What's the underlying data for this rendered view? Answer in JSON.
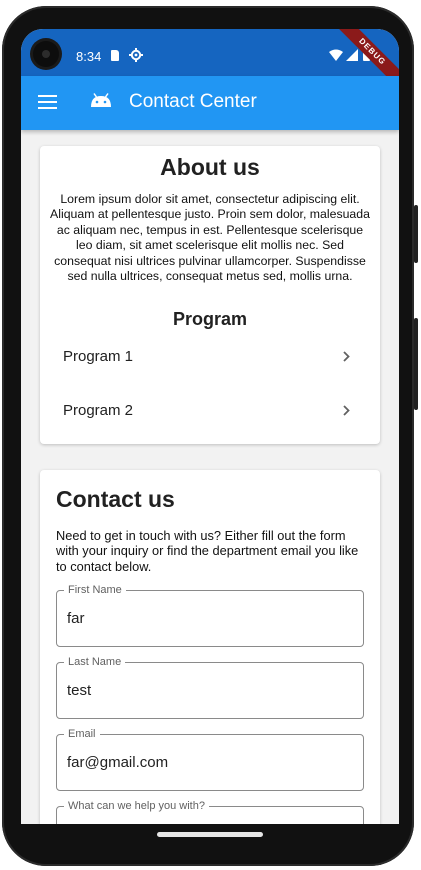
{
  "status_bar": {
    "time": "8:34",
    "debug_label": "DEBUG"
  },
  "app_bar": {
    "title": "Contact Center"
  },
  "about": {
    "title": "About us",
    "body": "Lorem ipsum dolor sit amet, consectetur adipiscing elit. Aliquam at pellentesque justo. Proin sem dolor, malesuada ac aliquam nec, tempus in est. Pellentesque scelerisque leo diam, sit amet scelerisque elit mollis nec. Sed consequat nisi ultrices pulvinar ullamcorper. Suspendisse sed nulla ultrices, consequat metus sed, mollis urna.",
    "program_title": "Program",
    "programs": [
      {
        "label": "Program 1"
      },
      {
        "label": "Program 2"
      }
    ]
  },
  "contact": {
    "title": "Contact us",
    "body": "Need to get in touch with us? Either fill out the form with your inquiry or find the department email you like to contact below.",
    "fields": {
      "first_name": {
        "label": "First Name",
        "value": "far"
      },
      "last_name": {
        "label": "Last Name",
        "value": "test"
      },
      "email": {
        "label": "Email",
        "value": "far@gmail.com"
      },
      "help": {
        "label": "What can we help you with?",
        "value": ""
      }
    }
  },
  "colors": {
    "app_bar": "#2196f3",
    "status_bar": "#1565c0",
    "background": "#f2f2f2",
    "debug_banner": "#8b1a1a"
  },
  "icons": [
    "menu-icon",
    "android-icon",
    "chevron-right-icon",
    "wifi-icon",
    "signal-icon",
    "battery-icon",
    "sd-card-icon",
    "gear-icon"
  ]
}
